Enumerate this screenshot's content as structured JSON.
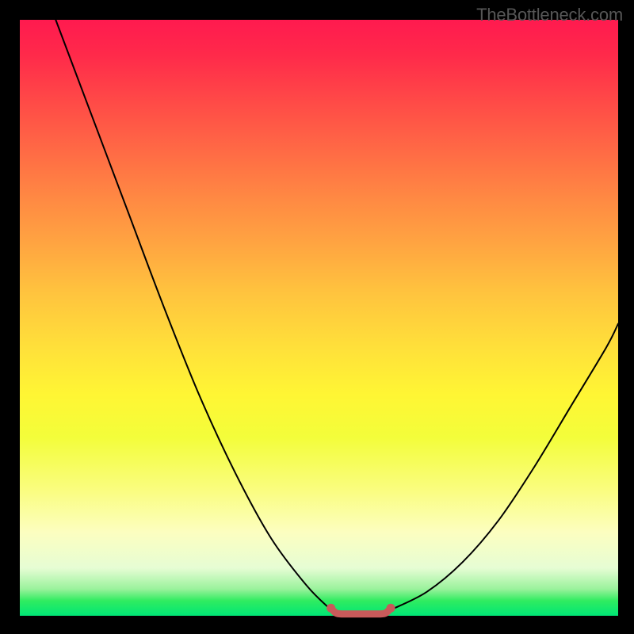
{
  "watermark": "TheBottleneck.com",
  "chart_data": {
    "type": "line",
    "title": "",
    "xlabel": "",
    "ylabel": "",
    "xlim": [
      0,
      100
    ],
    "ylim": [
      0,
      100
    ],
    "series": [
      {
        "name": "left-curve",
        "stroke": "#000000",
        "x": [
          6,
          12,
          18,
          24,
          30,
          36,
          42,
          48,
          52
        ],
        "values": [
          100,
          84,
          68,
          52,
          37,
          24,
          13,
          5,
          1
        ]
      },
      {
        "name": "right-curve",
        "stroke": "#000000",
        "x": [
          62,
          68,
          74,
          80,
          86,
          92,
          98,
          100
        ],
        "values": [
          1,
          4,
          9,
          16,
          25,
          35,
          45,
          49
        ]
      },
      {
        "name": "trough-marker",
        "stroke": "#c85a5a",
        "x": [
          52,
          53,
          55,
          57,
          59,
          61,
          62
        ],
        "values": [
          1.3,
          0.4,
          0.3,
          0.3,
          0.3,
          0.4,
          1.3
        ]
      }
    ],
    "gradient_stops": [
      {
        "pos": 0,
        "color": "#ff1a4f"
      },
      {
        "pos": 50,
        "color": "#ffd23a"
      },
      {
        "pos": 80,
        "color": "#fbfd9e"
      },
      {
        "pos": 97,
        "color": "#2fec60"
      },
      {
        "pos": 100,
        "color": "#00e676"
      }
    ]
  }
}
